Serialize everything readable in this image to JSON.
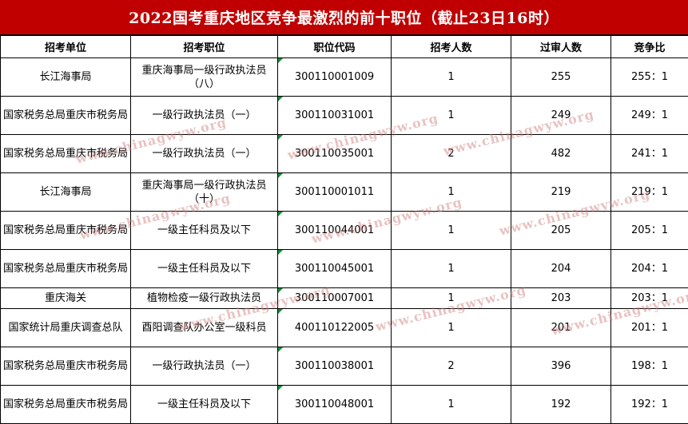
{
  "title": "2022国考重庆地区竞争最激烈的前十职位（截止23日16时）",
  "headers": [
    "招考单位",
    "招考职位",
    "职位代码",
    "招考人数",
    "过审人数",
    "竞争比"
  ],
  "rows": [
    {
      "unit": "长江海事局",
      "position": "重庆海事局一级行政执法员（八）",
      "code": "300110001009",
      "recruit": "1",
      "passed": "255",
      "ratio": "255：1"
    },
    {
      "unit": "国家税务总局重庆市税务局",
      "position": "一级行政执法员（一）",
      "code": "300110031001",
      "recruit": "1",
      "passed": "249",
      "ratio": "249：1"
    },
    {
      "unit": "国家税务总局重庆市税务局",
      "position": "一级行政执法员（一）",
      "code": "300110035001",
      "recruit": "2",
      "passed": "482",
      "ratio": "241：1"
    },
    {
      "unit": "长江海事局",
      "position": "重庆海事局一级行政执法员（十）",
      "code": "300110001011",
      "recruit": "1",
      "passed": "219",
      "ratio": "219：1"
    },
    {
      "unit": "国家税务总局重庆市税务局",
      "position": "一级主任科员及以下",
      "code": "300110044001",
      "recruit": "1",
      "passed": "205",
      "ratio": "205：1"
    },
    {
      "unit": "国家税务总局重庆市税务局",
      "position": "一级主任科员及以下",
      "code": "300110045001",
      "recruit": "1",
      "passed": "204",
      "ratio": "204：1"
    },
    {
      "unit": "重庆海关",
      "position": "植物检疫一级行政执法员",
      "code": "300110007001",
      "recruit": "1",
      "passed": "203",
      "ratio": "203：1"
    },
    {
      "unit": "国家统计局重庆调查总队",
      "position": "酉阳调查队办公室一级科员",
      "code": "400110122005",
      "recruit": "1",
      "passed": "201",
      "ratio": "201：1"
    },
    {
      "unit": "国家税务总局重庆市税务局",
      "position": "一级行政执法员（一）",
      "code": "300110038001",
      "recruit": "2",
      "passed": "396",
      "ratio": "198：1"
    },
    {
      "unit": "国家税务总局重庆市税务局",
      "position": "一级主任科员及以下",
      "code": "300110048001",
      "recruit": "1",
      "passed": "192",
      "ratio": "192：1"
    }
  ],
  "watermark_text": "www.chinagwyw.org",
  "colors": {
    "title_bg": "#c00000",
    "title_text": "#ffffff",
    "watermark": "#cd7878",
    "cell_marker": "#1a8a3a"
  }
}
